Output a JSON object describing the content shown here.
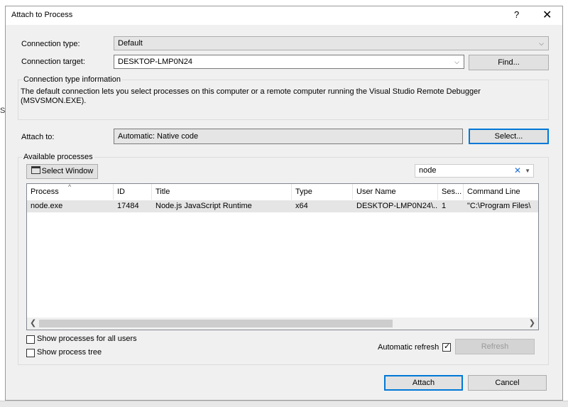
{
  "window": {
    "title": "Attach to Process",
    "help_label": "?",
    "close_label": "✕"
  },
  "background": {
    "left_hint": "S"
  },
  "connection": {
    "type_label": "Connection type:",
    "type_value": "Default",
    "target_label": "Connection target:",
    "target_value": "DESKTOP-LMP0N24",
    "find_button": "Find..."
  },
  "info": {
    "group_title": "Connection type information",
    "text": "The default connection lets you select processes on this computer or a remote computer running the Visual Studio Remote Debugger (MSVSMON.EXE)."
  },
  "attach_to": {
    "label": "Attach to:",
    "value": "Automatic: Native code",
    "select_button": "Select..."
  },
  "processes": {
    "group_title": "Available processes",
    "select_window_button": "Select Window",
    "search_value": "node",
    "columns": [
      "Process",
      "ID",
      "Title",
      "Type",
      "User Name",
      "Ses...",
      "Command Line"
    ],
    "rows": [
      {
        "process": "node.exe",
        "id": "17484",
        "title": "Node.js JavaScript Runtime",
        "type": "x64",
        "user": "DESKTOP-LMP0N24\\...",
        "session": "1",
        "command": "\"C:\\Program Files\\"
      }
    ]
  },
  "options": {
    "show_all_users": "Show processes for all users",
    "show_tree": "Show process tree",
    "auto_refresh": "Automatic refresh",
    "auto_refresh_checked": true,
    "refresh_button": "Refresh"
  },
  "footer": {
    "attach_button": "Attach",
    "cancel_button": "Cancel"
  },
  "icons": {
    "select_window": "window-edit-icon",
    "clear_search": "x-icon",
    "dropdown": "chevron-down-icon",
    "sort": "sort-up-icon"
  }
}
